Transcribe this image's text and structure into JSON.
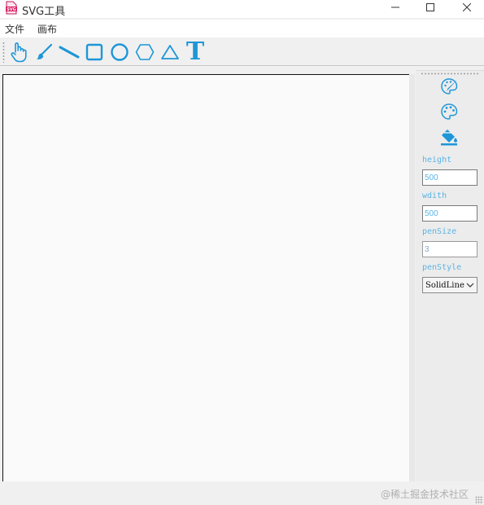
{
  "window": {
    "title": "SVG工具",
    "app_icon": "svg-file-icon",
    "controls": [
      "minimize-icon",
      "maximize-icon",
      "close-icon"
    ]
  },
  "menu": {
    "items": [
      {
        "label": "文件"
      },
      {
        "label": "画布"
      }
    ]
  },
  "toolbar": {
    "tools": [
      {
        "icon": "hand-pointer-icon"
      },
      {
        "icon": "brush-icon"
      },
      {
        "icon": "line-icon"
      },
      {
        "icon": "rectangle-icon"
      },
      {
        "icon": "circle-icon"
      },
      {
        "icon": "hexagon-icon"
      },
      {
        "icon": "triangle-icon"
      },
      {
        "icon": "text-icon",
        "glyph": "T"
      }
    ],
    "accent_color": "#1e96d8"
  },
  "side_panel": {
    "icons": [
      "pen-palette-icon",
      "palette-icon",
      "paint-bucket-icon"
    ],
    "height_label": "height",
    "height_value": "500",
    "width_label": "wdith",
    "width_value": "500",
    "pen_size_label": "penSize",
    "pen_size_value": "3",
    "pen_style_label": "penStyle",
    "pen_style_value": "SolidLine"
  },
  "watermark": "@稀土掘金技术社区"
}
